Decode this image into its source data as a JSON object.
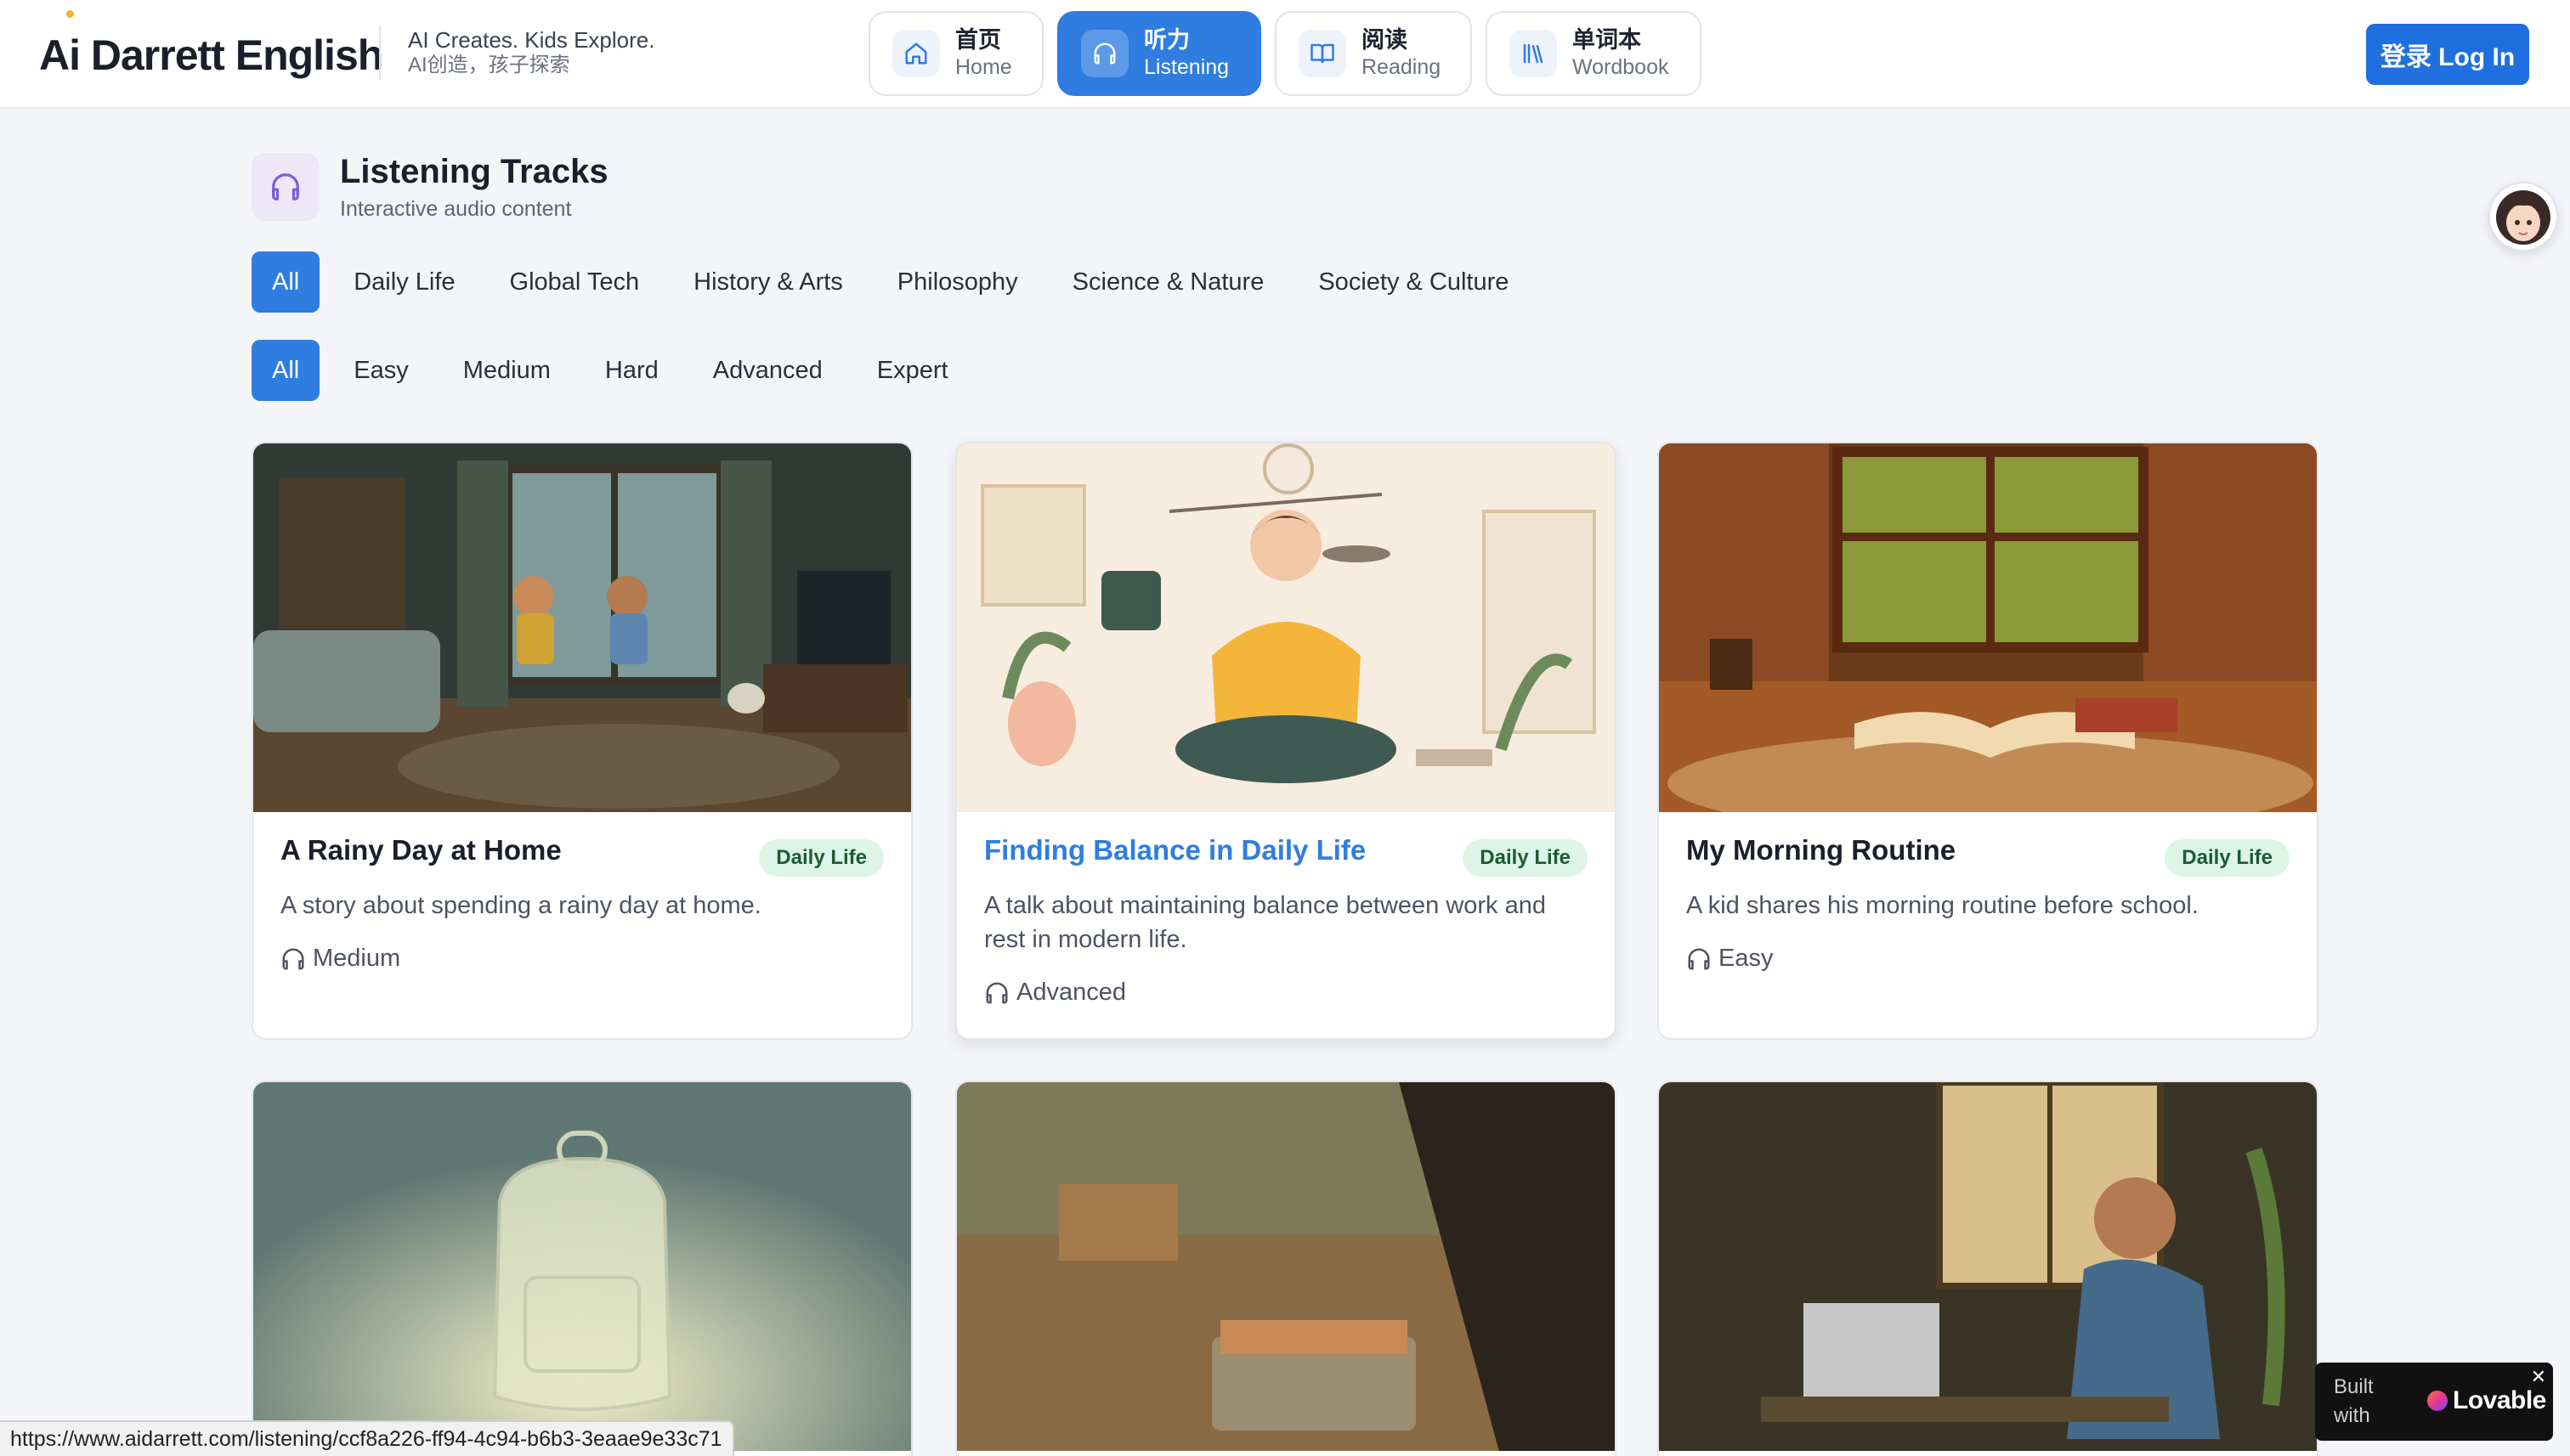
{
  "header": {
    "logo": "Ai Darrett English",
    "slogan_en": "AI Creates. Kids Explore.",
    "slogan_zh": "AI创造，孩子探索",
    "login_label": "登录 Log In"
  },
  "nav": [
    {
      "zh": "首页",
      "en": "Home",
      "icon": "home-icon",
      "active": false
    },
    {
      "zh": "听力",
      "en": "Listening",
      "icon": "headphones-icon",
      "active": true
    },
    {
      "zh": "阅读",
      "en": "Reading",
      "icon": "book-open-icon",
      "active": false
    },
    {
      "zh": "单词本",
      "en": "Wordbook",
      "icon": "library-icon",
      "active": false
    }
  ],
  "page": {
    "title": "Listening Tracks",
    "subtitle": "Interactive audio content"
  },
  "category_filters": [
    "All",
    "Daily Life",
    "Global Tech",
    "History & Arts",
    "Philosophy",
    "Science & Nature",
    "Society & Culture"
  ],
  "level_filters": [
    "All",
    "Easy",
    "Medium",
    "Hard",
    "Advanced",
    "Expert"
  ],
  "tracks": [
    {
      "title": "A Rainy Day at Home",
      "category": "Daily Life",
      "description": "A story about spending a rainy day at home.",
      "level": "Medium"
    },
    {
      "title": "Finding Balance in Daily Life",
      "category": "Daily Life",
      "description": "A talk about maintaining balance between work and rest in modern life.",
      "level": "Advanced"
    },
    {
      "title": "My Morning Routine",
      "category": "Daily Life",
      "description": "A kid shares his morning routine before school.",
      "level": "Easy"
    }
  ],
  "status_url": "https://www.aidarrett.com/listening/ccf8a226-ff94-4c94-b6b3-3eaae9e33c71",
  "lovable": {
    "built_line1": "Built",
    "built_line2": "with",
    "brand": "Lovable",
    "close": "✕"
  },
  "colors": {
    "accent": "#2f7de1",
    "badge_bg": "#dcf5e6",
    "badge_text": "#1c5b34"
  }
}
